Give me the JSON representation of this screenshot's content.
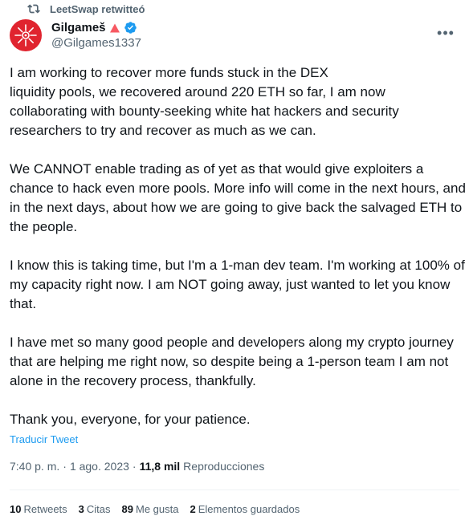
{
  "retweet": {
    "icon": "retweet-icon",
    "label": "LeetSwap retwitteó"
  },
  "author": {
    "display_name": "Gilgameš",
    "handle": "@Gilgames1337",
    "avatar_color": "#e0242f",
    "badge_icon": "warning-triangle-icon",
    "verified_icon": "verified-badge-icon",
    "verified_color": "#1d9bf0"
  },
  "more_button": "•••",
  "tweet": {
    "paragraphs": [
      "I am working to recover more funds stuck in the DEX\nliquidity pools, we recovered around 220 ETH so far, I am now collaborating with bounty-seeking white hat hackers and security researchers to try and recover as much as we can.",
      "We CANNOT enable trading as of yet as that would give exploiters a chance to hack even more pools. More info will come in the next hours, and in the next days, about how we are going to give back the salvaged ETH to the people.",
      "I know this is taking time, but I'm a 1-man dev team. I'm working at 100% of my capacity right now. I am NOT going away, just wanted to let you know that.",
      "I have met so many good people and developers along my crypto journey that are helping me right now, so despite being a 1-person team I am not alone in the recovery process, thankfully.",
      "Thank you, everyone, for your patience."
    ],
    "translate_label": "Traducir Tweet"
  },
  "meta": {
    "time": "7:40 p. m.",
    "separator": "·",
    "date": "1 ago. 2023",
    "views_count": "11,8 mil",
    "views_label": "Reproducciones"
  },
  "stats": [
    {
      "count": "10",
      "label": "Retweets"
    },
    {
      "count": "3",
      "label": "Citas"
    },
    {
      "count": "89",
      "label": "Me gusta"
    },
    {
      "count": "2",
      "label": "Elementos guardados"
    }
  ]
}
